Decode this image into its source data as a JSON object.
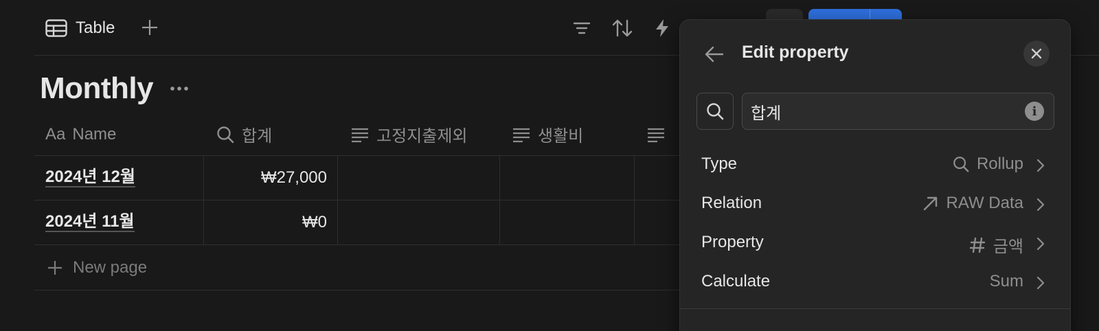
{
  "toolbar": {
    "view_tab_label": "Table",
    "icons": [
      "table-icon",
      "plus-icon",
      "filter-icon",
      "sort-icon",
      "automation-icon",
      "search-icon"
    ]
  },
  "database": {
    "title": "Monthly",
    "more_icon": "ellipsis-icon"
  },
  "table": {
    "columns": [
      {
        "icon": "text-aa",
        "icon_text": "Aa",
        "label": "Name"
      },
      {
        "icon": "search-icon",
        "label": "합계"
      },
      {
        "icon": "lines-icon",
        "label": "고정지출제외"
      },
      {
        "icon": "lines-icon",
        "label": "생활비"
      },
      {
        "icon": "lines-icon",
        "label": ""
      }
    ],
    "rows": [
      {
        "name": "2024년 12월",
        "total": "₩27,000"
      },
      {
        "name": "2024년 11월",
        "total": "₩0"
      }
    ],
    "new_page_label": "New page"
  },
  "panel": {
    "title": "Edit property",
    "name_value": "합계",
    "info_glyph": "i",
    "rows": [
      {
        "key": "Type",
        "value": "Rollup",
        "icon": "search-icon"
      },
      {
        "key": "Relation",
        "value": "RAW Data",
        "icon": "arrow-up-right-icon"
      },
      {
        "key": "Property",
        "value": "금액",
        "icon": "hash-icon"
      },
      {
        "key": "Calculate",
        "value": "Sum",
        "icon": ""
      }
    ]
  },
  "colors": {
    "background": "#191919",
    "panel": "#252525",
    "accent_blue": "#2e6fdb",
    "text_primary": "#e6e6e6",
    "text_muted": "#8e8e8e"
  }
}
